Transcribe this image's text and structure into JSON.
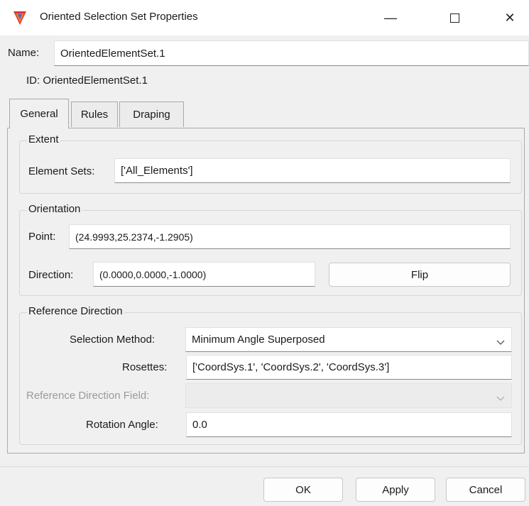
{
  "window": {
    "title": "Oriented Selection Set Properties",
    "icons": {
      "app": "app-logo-icon",
      "minimize": "minimize-icon",
      "maximize": "maximize-icon",
      "close": "close-icon"
    },
    "min_glyph": "—",
    "close_glyph": "✕"
  },
  "header": {
    "name_label": "Name:",
    "name_value": "OrientedElementSet.1",
    "id_text": "ID: OrientedElementSet.1"
  },
  "tabs": [
    {
      "label": "General",
      "active": true
    },
    {
      "label": "Rules",
      "active": false
    },
    {
      "label": "Draping",
      "active": false
    }
  ],
  "extent": {
    "title": "Extent",
    "element_sets_label": "Element Sets:",
    "element_sets_value": "['All_Elements']"
  },
  "orientation": {
    "title": "Orientation",
    "point_label": "Point:",
    "point_value": "(24.9993,25.2374,-1.2905)",
    "direction_label": "Direction:",
    "direction_value": "(0.0000,0.0000,-1.0000)",
    "flip_label": "Flip"
  },
  "reference_direction": {
    "title": "Reference Direction",
    "selection_method_label": "Selection Method:",
    "selection_method_value": "Minimum Angle Superposed",
    "rosettes_label": "Rosettes:",
    "rosettes_value": "['CoordSys.1', 'CoordSys.2', 'CoordSys.3']",
    "field_label": "Reference Direction Field:",
    "field_value": "",
    "rotation_angle_label": "Rotation Angle:",
    "rotation_angle_value": "0.0"
  },
  "footer": {
    "ok_label": "OK",
    "apply_label": "Apply",
    "cancel_label": "Cancel"
  },
  "colors": {
    "accent_red": "#e0342c",
    "accent_blue": "#2f6fd6",
    "background": "#f0f0f0"
  }
}
